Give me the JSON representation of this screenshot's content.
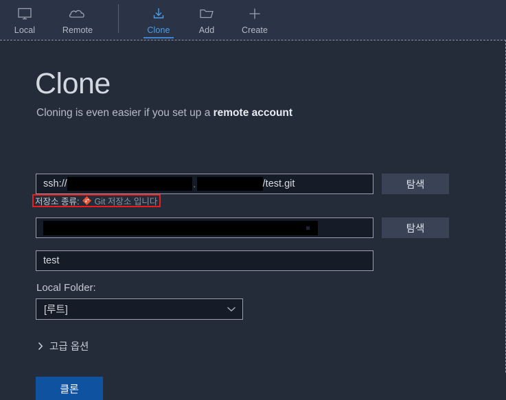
{
  "toolbar": {
    "items": [
      {
        "id": "local",
        "label": "Local",
        "icon": "monitor-icon",
        "active": false
      },
      {
        "id": "remote",
        "label": "Remote",
        "icon": "cloud-icon",
        "active": false
      },
      {
        "id": "clone",
        "label": "Clone",
        "icon": "download-icon",
        "active": true
      },
      {
        "id": "add",
        "label": "Add",
        "icon": "folder-icon",
        "active": false
      },
      {
        "id": "create",
        "label": "Create",
        "icon": "plus-icon",
        "active": false
      }
    ]
  },
  "page": {
    "title": "Clone",
    "subtitle_prefix": "Cloning is even easier if you set up a ",
    "subtitle_link": "remote account"
  },
  "form": {
    "source_url": {
      "prefix": "ssh://",
      "separator": ".",
      "suffix": "/test.git",
      "redacted": true
    },
    "destination_path": {
      "value": "",
      "redacted": true
    },
    "name": {
      "value": "test"
    },
    "browse_label": "탐색",
    "repo_type": {
      "label": "저장소 종류:",
      "icon": "git-logo-icon",
      "value": "Git 저장소 입니다",
      "highlight_color": "#ee1c1c"
    },
    "local_folder": {
      "label": "Local Folder:",
      "selected": "[루트]",
      "options": [
        "[루트]"
      ]
    },
    "advanced_options": {
      "label": "고급 옵션",
      "expanded": false
    },
    "submit_label": "클론"
  },
  "colors": {
    "background": "#242b39",
    "toolbar_background": "#2b3347",
    "accent_blue": "#4a9eea",
    "primary_button": "#0f52a0",
    "git_orange": "#f05033",
    "annotation_red": "#ee1c1c"
  }
}
